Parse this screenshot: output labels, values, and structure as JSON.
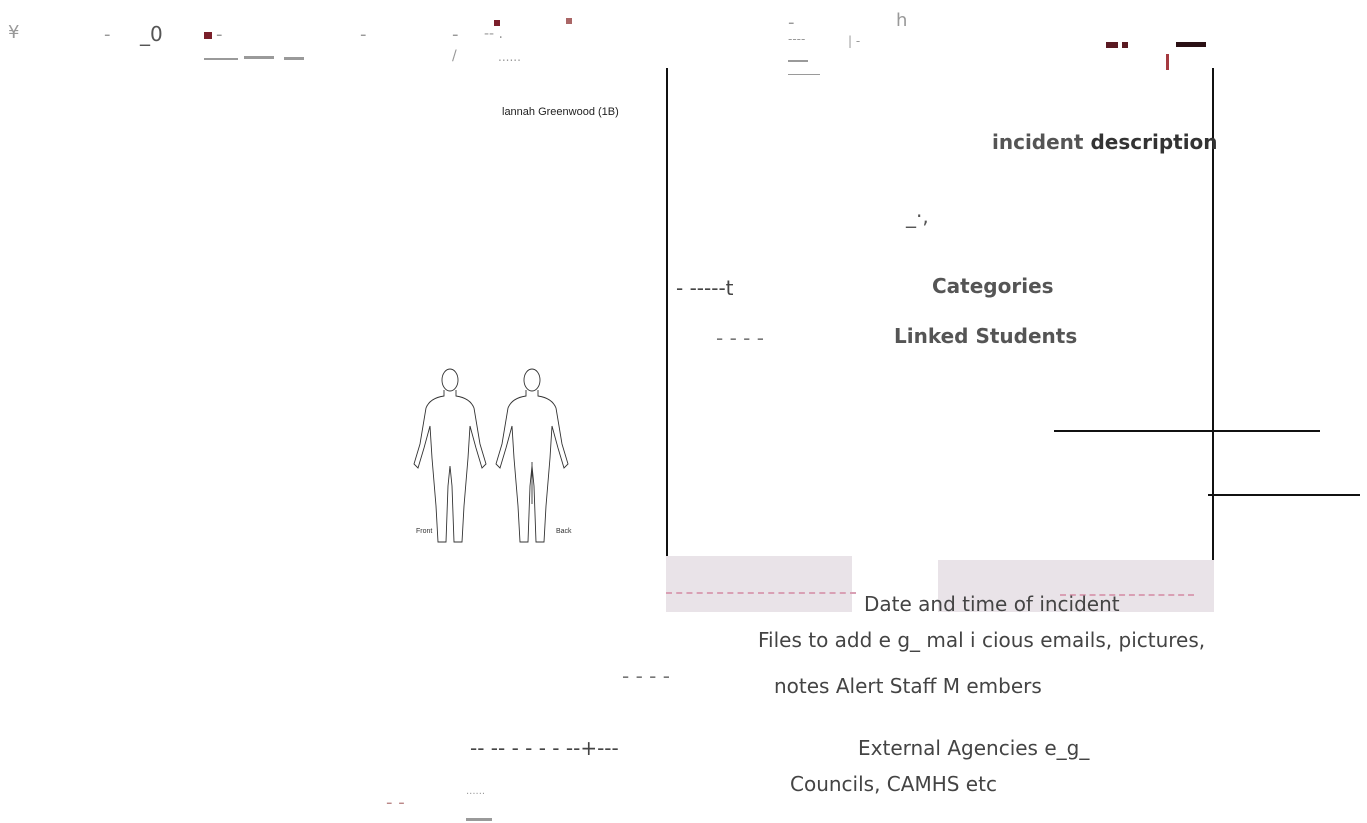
{
  "header_fragments": {
    "yen": "¥",
    "dash_a": "-",
    "zero": "_0",
    "dash_b": "-",
    "dash_c": "-",
    "double_dash": "-- .",
    "slash": "/",
    "dots": "......",
    "h_char": "h",
    "dash_d": "-",
    "dash_e": "----",
    "pipe_dash": "| -"
  },
  "student_name": "lannah Greenwood (1B)",
  "body_map": {
    "front_label": "Front",
    "back_label": "Back"
  },
  "labels": {
    "incident_description_a": "incident ",
    "incident_description_b": "description",
    "squiggle": "_·,",
    "dash_run_left": "-    -----t",
    "categories": "Categories",
    "linked_dashes": "-    -    -    -",
    "linked_students": "Linked Students",
    "date_time": "Date and time of incident",
    "files_line": "Files to add e g_ mal   i cious emails, pictures,",
    "dashes_mid": "-    -    - -",
    "notes_line": "notes Alert Staff M embers",
    "dashes_lower": "--   --   -   -   -   -   --+---",
    "external_line1": "External Agencies e_g_",
    "external_line2": "Councils, CAMHS etc",
    "bottom_dashes": "-  -",
    "bottom_dots": "......"
  }
}
